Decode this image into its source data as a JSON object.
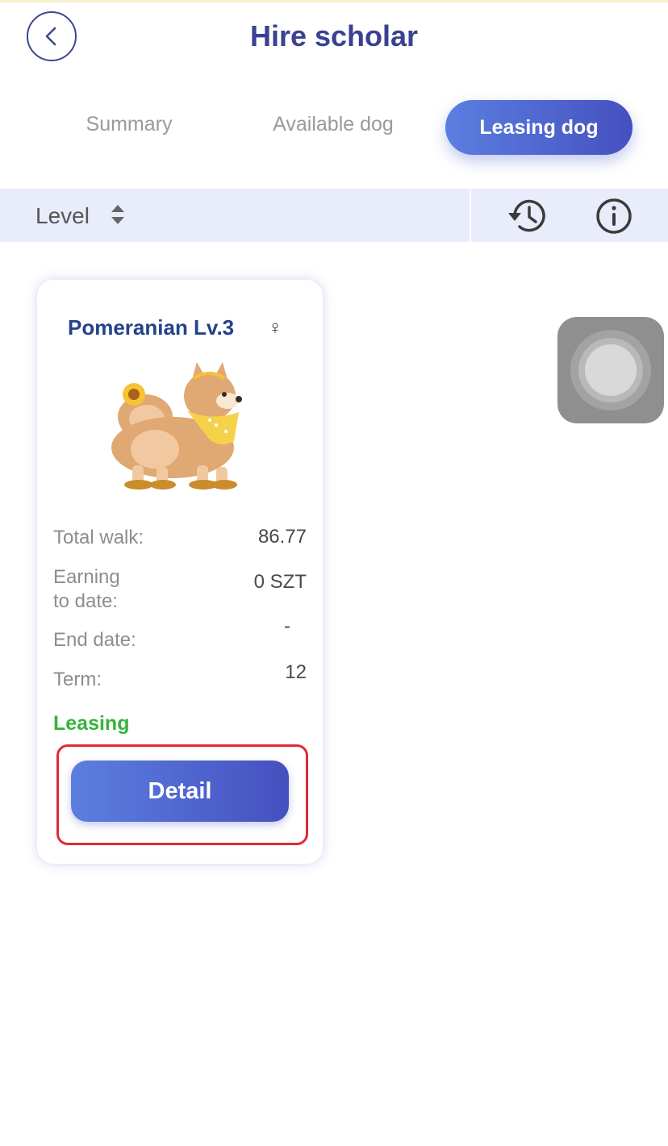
{
  "header": {
    "title": "Hire scholar"
  },
  "tabs": [
    {
      "label": "Summary",
      "active": false
    },
    {
      "label": "Available dog",
      "active": false
    },
    {
      "label": "Leasing dog",
      "active": true
    }
  ],
  "filter": {
    "sort_label": "Level",
    "icons": [
      "sort-icon",
      "history-icon",
      "info-icon"
    ]
  },
  "dog_card": {
    "name": "Pomeranian Lv.3",
    "gender_symbol": "♀",
    "stats": [
      {
        "label": "Total walk:",
        "value": "86.77"
      },
      {
        "label": "Earning to date:",
        "label_line1": "Earning",
        "label_line2": "to date:",
        "value": "0 SZT"
      },
      {
        "label": "End date:",
        "value": "-"
      },
      {
        "label": "Term:",
        "value": "12"
      }
    ],
    "status": "Leasing",
    "detail_button": "Detail"
  },
  "colors": {
    "accent": "#4a5fd0",
    "title": "#3a4192",
    "status_green": "#37b33c",
    "highlight": "#e02a35"
  }
}
